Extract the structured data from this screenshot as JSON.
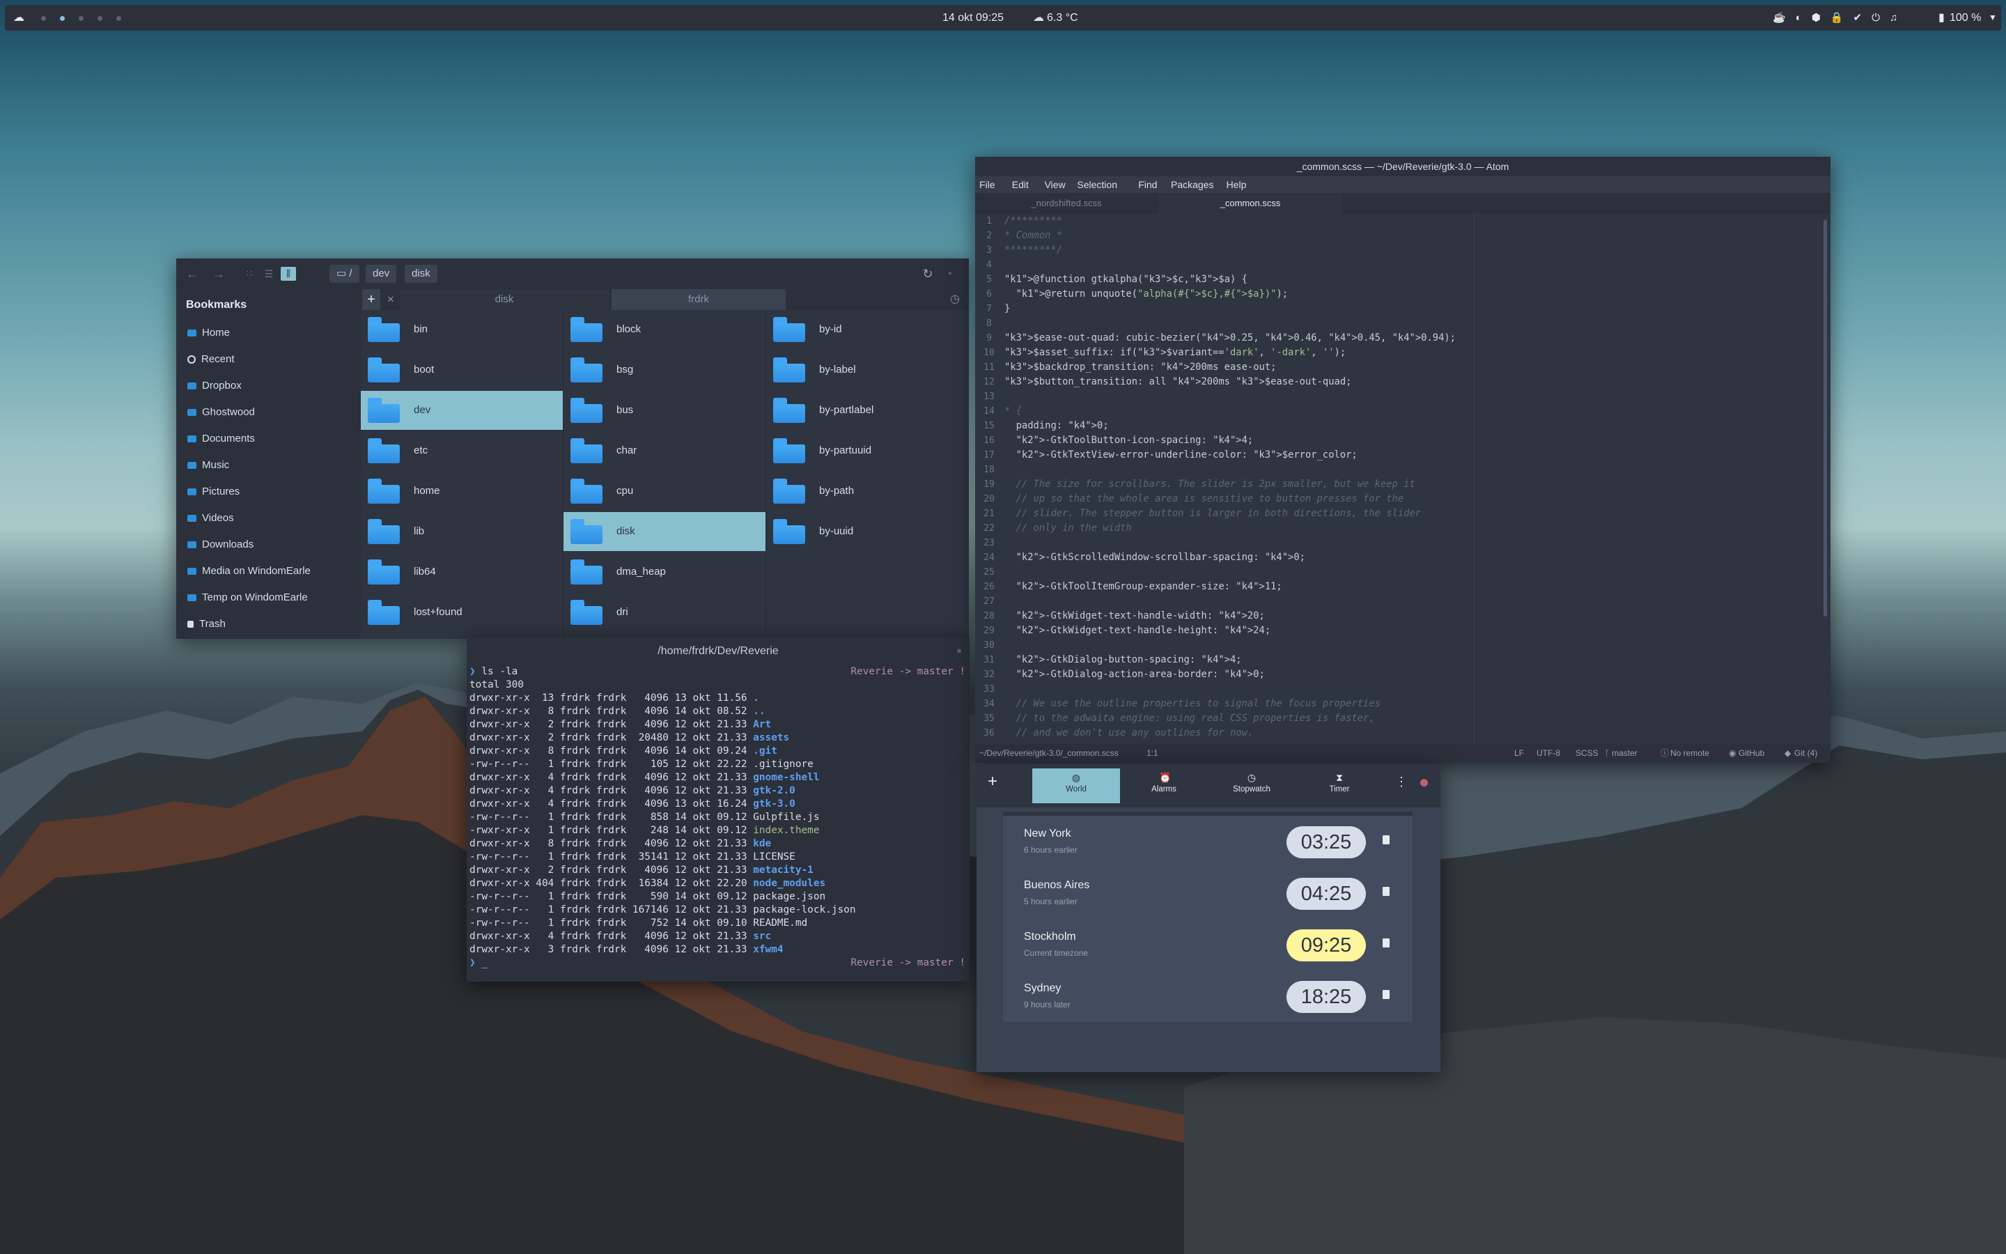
{
  "topbar": {
    "datetime": "14 okt  09:25",
    "weather": "6.3 °C",
    "battery": "100 %"
  },
  "file_manager": {
    "breadcrumb": [
      "/",
      "dev",
      "disk"
    ],
    "bookmarks_title": "Bookmarks",
    "bookmarks": [
      "Home",
      "Recent",
      "Dropbox",
      "Ghostwood",
      "Documents",
      "Music",
      "Pictures",
      "Videos",
      "Downloads",
      "Media on WindomEarle",
      "Temp on WindomEarle",
      "Trash"
    ],
    "tabs": [
      "disk",
      "frdrk"
    ],
    "col1": [
      "bin",
      "boot",
      "dev",
      "etc",
      "home",
      "lib",
      "lib64",
      "lost+found"
    ],
    "col2": [
      "block",
      "bsg",
      "bus",
      "char",
      "cpu",
      "disk",
      "dma_heap",
      "dri"
    ],
    "col3": [
      "by-id",
      "by-label",
      "by-partlabel",
      "by-partuuid",
      "by-path",
      "by-uuid"
    ]
  },
  "terminal": {
    "title": "/home/frdrk/Dev/Reverie",
    "command": "ls -la",
    "prompt_right": "Reverie -> master",
    "prompt_flag": "!",
    "total": "total 300",
    "lines": [
      {
        "meta": "drwxr-xr-x  13 frdrk frdrk   4096 13 okt 11.56 ",
        "name": ".",
        "cls": "blue"
      },
      {
        "meta": "drwxr-xr-x   8 frdrk frdrk   4096 14 okt 08.52 ",
        "name": "..",
        "cls": "blue"
      },
      {
        "meta": "drwxr-xr-x   2 frdrk frdrk   4096 12 okt 21.33 ",
        "name": "Art",
        "cls": "blue"
      },
      {
        "meta": "drwxr-xr-x   2 frdrk frdrk  20480 12 okt 21.33 ",
        "name": "assets",
        "cls": "blue"
      },
      {
        "meta": "drwxr-xr-x   8 frdrk frdrk   4096 14 okt 09.24 ",
        "name": ".git",
        "cls": "blue"
      },
      {
        "meta": "-rw-r--r--   1 frdrk frdrk    105 12 okt 22.22 ",
        "name": ".gitignore",
        "cls": ""
      },
      {
        "meta": "drwxr-xr-x   4 frdrk frdrk   4096 12 okt 21.33 ",
        "name": "gnome-shell",
        "cls": "blue"
      },
      {
        "meta": "drwxr-xr-x   4 frdrk frdrk   4096 12 okt 21.33 ",
        "name": "gtk-2.0",
        "cls": "blue"
      },
      {
        "meta": "drwxr-xr-x   4 frdrk frdrk   4096 13 okt 16.24 ",
        "name": "gtk-3.0",
        "cls": "blue"
      },
      {
        "meta": "-rw-r--r--   1 frdrk frdrk    858 14 okt 09.12 ",
        "name": "Gulpfile.js",
        "cls": ""
      },
      {
        "meta": "-rwxr-xr-x   1 frdrk frdrk    248 14 okt 09.12 ",
        "name": "index.theme",
        "cls": "green"
      },
      {
        "meta": "drwxr-xr-x   8 frdrk frdrk   4096 12 okt 21.33 ",
        "name": "kde",
        "cls": "blue"
      },
      {
        "meta": "-rw-r--r--   1 frdrk frdrk  35141 12 okt 21.33 ",
        "name": "LICENSE",
        "cls": ""
      },
      {
        "meta": "drwxr-xr-x   2 frdrk frdrk   4096 12 okt 21.33 ",
        "name": "metacity-1",
        "cls": "blue"
      },
      {
        "meta": "drwxr-xr-x 404 frdrk frdrk  16384 12 okt 22.20 ",
        "name": "node_modules",
        "cls": "blue"
      },
      {
        "meta": "-rw-r--r--   1 frdrk frdrk    590 14 okt 09.12 ",
        "name": "package.json",
        "cls": ""
      },
      {
        "meta": "-rw-r--r--   1 frdrk frdrk 167146 12 okt 21.33 ",
        "name": "package-lock.json",
        "cls": ""
      },
      {
        "meta": "-rw-r--r--   1 frdrk frdrk    752 14 okt 09.10 ",
        "name": "README.md",
        "cls": ""
      },
      {
        "meta": "drwxr-xr-x   4 frdrk frdrk   4096 12 okt 21.33 ",
        "name": "src",
        "cls": "blue"
      },
      {
        "meta": "drwxr-xr-x   3 frdrk frdrk   4096 12 okt 21.33 ",
        "name": "xfwm4",
        "cls": "blue"
      }
    ]
  },
  "atom": {
    "title": "_common.scss — ~/Dev/Reverie/gtk-3.0 — Atom",
    "menu": [
      "File",
      "Edit",
      "View",
      "Selection",
      "Find",
      "Packages",
      "Help"
    ],
    "tabs": [
      "_nordshifted.scss",
      "_common.scss"
    ],
    "status_left": "~/Dev/Reverie/gtk-3.0/_common.scss",
    "status_pos": "1:1",
    "status_right": [
      "LF",
      "UTF-8",
      "SCSS",
      "master",
      "No remote",
      "GitHub",
      "Git (4)"
    ],
    "lines": [
      "/*********",
      "* Common *",
      "*********/",
      "",
      "@function gtkalpha($c,$a) {",
      "  @return unquote(\"alpha(#{$c},#{$a})\");",
      "}",
      "",
      "$ease-out-quad: cubic-bezier(0.25, 0.46, 0.45, 0.94);",
      "$asset_suffix: if($variant=='dark', '-dark', '');",
      "$backdrop_transition: 200ms ease-out;",
      "$button_transition: all 200ms $ease-out-quad;",
      "",
      "* {",
      "  padding: 0;",
      "  -GtkToolButton-icon-spacing: 4;",
      "  -GtkTextView-error-underline-color: $error_color;",
      "",
      "  // The size for scrollbars. The slider is 2px smaller, but we keep it",
      "  // up so that the whole area is sensitive to button presses for the",
      "  // slider. The stepper button is larger in both directions, the slider",
      "  // only in the width",
      "",
      "  -GtkScrolledWindow-scrollbar-spacing: 0;",
      "",
      "  -GtkToolItemGroup-expander-size: 11;",
      "",
      "  -GtkWidget-text-handle-width: 20;",
      "  -GtkWidget-text-handle-height: 24;",
      "",
      "  -GtkDialog-button-spacing: 4;",
      "  -GtkDialog-action-area-border: 0;",
      "",
      "  // We use the outline properties to signal the focus properties",
      "  // to the adwaita engine: using real CSS properties is faster,",
      "  // and we don't use any outlines for now."
    ]
  },
  "clock": {
    "tabs": [
      "World",
      "Alarms",
      "Stopwatch",
      "Timer"
    ],
    "cities": [
      {
        "city": "New York",
        "sub": "6 hours earlier",
        "time": "03:25"
      },
      {
        "city": "Buenos Aires",
        "sub": "5 hours earlier",
        "time": "04:25"
      },
      {
        "city": "Stockholm",
        "sub": "Current timezone",
        "time": "09:25"
      },
      {
        "city": "Sydney",
        "sub": "9 hours later",
        "time": "18:25"
      }
    ]
  }
}
